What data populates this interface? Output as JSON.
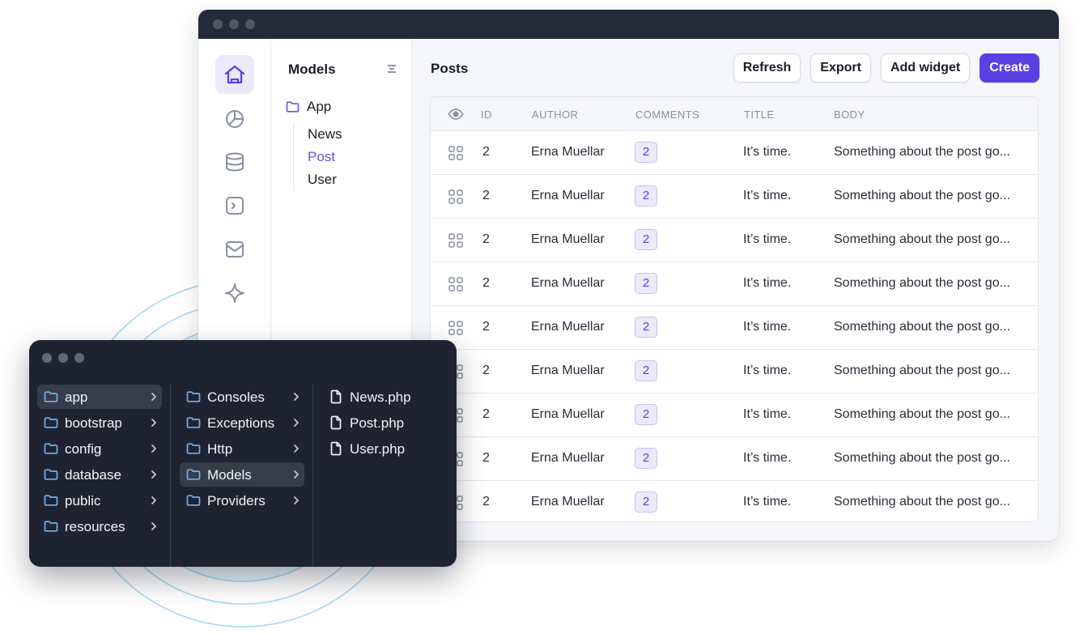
{
  "models_panel": {
    "title": "Models",
    "root": "App",
    "children": [
      {
        "label": "News",
        "active": false
      },
      {
        "label": "Post",
        "active": true
      },
      {
        "label": "User",
        "active": false
      }
    ]
  },
  "rail": {
    "icons": [
      "home-icon",
      "pie-chart-icon",
      "database-icon",
      "terminal-icon",
      "mail-icon",
      "sparkle-icon"
    ]
  },
  "main": {
    "title": "Posts",
    "buttons": {
      "refresh": "Refresh",
      "export": "Export",
      "add_widget": "Add widget",
      "create": "Create"
    }
  },
  "table": {
    "headers": [
      "ID",
      "AUTHOR",
      "COMMENTS",
      "TITLE",
      "BODY"
    ],
    "rows": [
      {
        "id": "2",
        "author": "Erna Muellar",
        "comments": "2",
        "title": "It’s time.",
        "body": "Something about the post go..."
      },
      {
        "id": "2",
        "author": "Erna Muellar",
        "comments": "2",
        "title": "It’s time.",
        "body": "Something about the post go..."
      },
      {
        "id": "2",
        "author": "Erna Muellar",
        "comments": "2",
        "title": "It’s time.",
        "body": "Something about the post go..."
      },
      {
        "id": "2",
        "author": "Erna Muellar",
        "comments": "2",
        "title": "It’s time.",
        "body": "Something about the post go..."
      },
      {
        "id": "2",
        "author": "Erna Muellar",
        "comments": "2",
        "title": "It’s time.",
        "body": "Something about the post go..."
      },
      {
        "id": "2",
        "author": "Erna Muellar",
        "comments": "2",
        "title": "It’s time.",
        "body": "Something about the post go..."
      },
      {
        "id": "2",
        "author": "Erna Muellar",
        "comments": "2",
        "title": "It’s time.",
        "body": "Something about the post go..."
      },
      {
        "id": "2",
        "author": "Erna Muellar",
        "comments": "2",
        "title": "It’s time.",
        "body": "Something about the post go..."
      },
      {
        "id": "2",
        "author": "Erna Muellar",
        "comments": "2",
        "title": "It’s time.",
        "body": "Something about the post go..."
      }
    ]
  },
  "file_browser": {
    "col1": [
      {
        "label": "app",
        "selected": true
      },
      {
        "label": "bootstrap",
        "selected": false
      },
      {
        "label": "config",
        "selected": false
      },
      {
        "label": "database",
        "selected": false
      },
      {
        "label": "public",
        "selected": false
      },
      {
        "label": "resources",
        "selected": false
      }
    ],
    "col2": [
      {
        "label": "Consoles",
        "selected": false
      },
      {
        "label": "Exceptions",
        "selected": false
      },
      {
        "label": "Http",
        "selected": false
      },
      {
        "label": "Models",
        "selected": true
      },
      {
        "label": "Providers",
        "selected": false
      }
    ],
    "col3": [
      {
        "label": "News.php"
      },
      {
        "label": "Post.php"
      },
      {
        "label": "User.php"
      }
    ]
  },
  "colors": {
    "accent": "#5b3fe3",
    "accent_soft": "#ece9fb",
    "dark_panel": "#1f2331",
    "titlebar": "#252a39",
    "folder_blue": "#6fb2e8",
    "ring_blue": "#8fd0f2"
  }
}
